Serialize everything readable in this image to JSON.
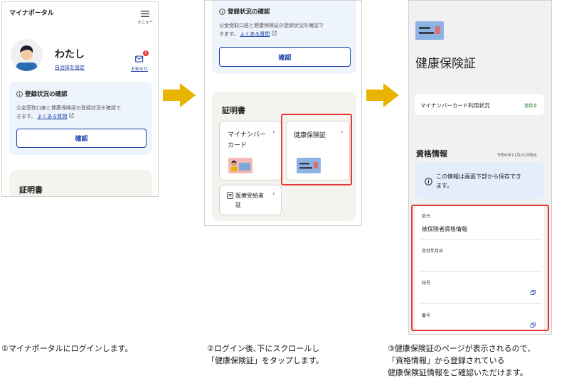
{
  "screen1": {
    "app_title": "マイナポータル",
    "menu_label": "メニュー",
    "user_name": "わたし",
    "set_municipality_link": "自治体を設定",
    "notice_label": "お知らせ",
    "notice_badge": "1",
    "status_title": "登録状況の確認",
    "status_body_1": "公金受取口座と健康保険証の登録状況を確認で",
    "status_body_2": "きます。",
    "faq_link": "よくある質問",
    "confirm_button": "確認",
    "certificates_heading": "証明書"
  },
  "screen2": {
    "status_title": "登録状況の確認",
    "status_body_1": "公金受取口座と健康保険証の登録状況を確認で",
    "status_body_2": "きます。",
    "faq_link": "よくある質問",
    "confirm_button": "確認",
    "certificates_heading": "証明書",
    "my_number_card_1": "マイナンバー",
    "my_number_card_2": "カード",
    "health_insurance_card": "健康保険証",
    "medical_recipient_1": "医療受給者",
    "medical_recipient_2": "証"
  },
  "screen3": {
    "page_title": "健康保険証",
    "usage_status_label": "マイナンバーカード利用状況",
    "usage_status_value": "登録済",
    "qualification_heading": "資格情報",
    "as_of_date": "令和6年11月21日時点",
    "info_notice_1": "この情報は画面下部から保存でき",
    "info_notice_2": "ます。",
    "field_category_label": "区分",
    "field_category_value": "被保険者資格情報",
    "field_issue_date_label": "交付年月日",
    "field_symbol_label": "記号",
    "field_number_label": "番号"
  },
  "captions": {
    "step1": "①マイナポータルにログインします。",
    "step2_line1": "②ログイン後､下にスクロールし",
    "step2_line2": "「健康保険証」をタップします。",
    "step3_line1": "③健康保険証のページが表示されるので、",
    "step3_line2": "「資格情報」から登録されている",
    "step3_line3": "健康保険証情報をご確認いただけます。"
  },
  "colors": {
    "accent_blue": "#1a3fa8",
    "arrow_yellow": "#e8b400",
    "highlight_red": "#e53935",
    "panel_blue": "#eef4fc",
    "registered_green": "#2e7d32"
  }
}
